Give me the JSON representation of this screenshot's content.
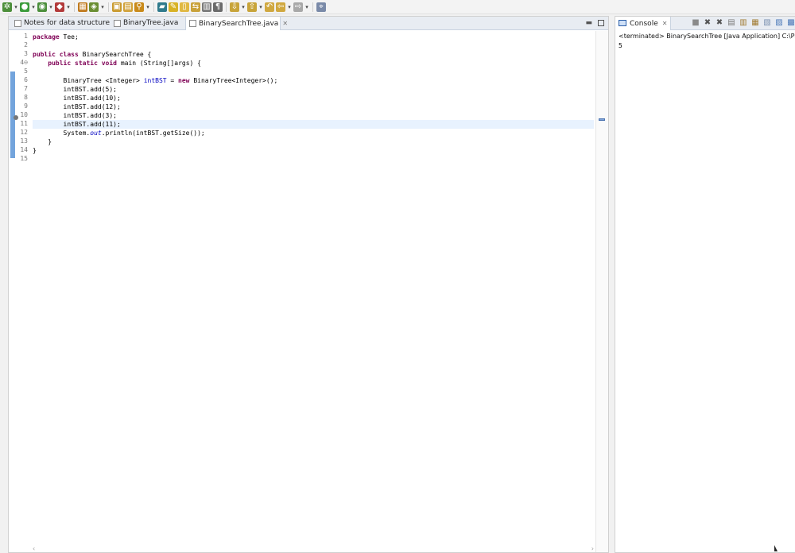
{
  "toolbar": {
    "icons": [
      {
        "name": "debug-icon",
        "color": "#4d8f3a"
      },
      {
        "name": "run-icon",
        "color": "#3b9b3b"
      },
      {
        "name": "coverage-icon",
        "color": "#4b8e3b"
      },
      {
        "name": "external-tools-icon",
        "color": "#b33a3a"
      },
      {
        "name": "new-java-project-icon",
        "color": "#c07a1e"
      },
      {
        "name": "new-package-icon",
        "color": "#6a8e32"
      },
      {
        "name": "open-type-icon",
        "color": "#c99a2e"
      },
      {
        "name": "open-folder-icon",
        "color": "#d1a23a"
      },
      {
        "name": "search-icon",
        "color": "#c98a1a"
      },
      {
        "name": "toggle-mark-occurrences-icon",
        "color": "#2f7a8c"
      },
      {
        "name": "highlight-icon",
        "color": "#d8b226"
      },
      {
        "name": "block-selection-icon",
        "color": "#e0b842"
      },
      {
        "name": "word-wrap-icon",
        "color": "#c9a23a"
      },
      {
        "name": "show-whitespace-icon",
        "color": "#7a7a7a"
      },
      {
        "name": "pilcrow-icon",
        "color": "#6b6b6b"
      },
      {
        "name": "next-annotation-icon",
        "color": "#c8a43a"
      },
      {
        "name": "previous-annotation-icon",
        "color": "#c8a43a"
      },
      {
        "name": "last-edit-location-icon",
        "color": "#d0a840"
      },
      {
        "name": "back-icon",
        "color": "#d0a840"
      },
      {
        "name": "forward-icon",
        "color": "#a8a8a8"
      },
      {
        "name": "pin-editor-icon",
        "color": "#7a8aa8"
      }
    ]
  },
  "editor": {
    "tabs": [
      {
        "label": "Notes for data structure",
        "active": false
      },
      {
        "label": "BinaryTree.java",
        "active": false
      },
      {
        "label": "BinarySearchTree.java",
        "active": true
      }
    ],
    "line_numbers": [
      "1",
      "2",
      "3",
      "4⊖",
      "5",
      "6",
      "7",
      "8",
      "9",
      "10",
      "11",
      "12",
      "13",
      "14",
      "15"
    ],
    "current_line": 11,
    "lines": [
      [
        {
          "t": "package",
          "c": "kw"
        },
        {
          "t": " Tee;",
          "c": ""
        }
      ],
      [],
      [
        {
          "t": "public",
          "c": "kw"
        },
        {
          "t": " ",
          "c": ""
        },
        {
          "t": "class",
          "c": "kw"
        },
        {
          "t": " BinarySearchTree {",
          "c": ""
        }
      ],
      [
        {
          "t": "    ",
          "c": ""
        },
        {
          "t": "public",
          "c": "kw"
        },
        {
          "t": " ",
          "c": ""
        },
        {
          "t": "static",
          "c": "kw"
        },
        {
          "t": " ",
          "c": ""
        },
        {
          "t": "void",
          "c": "kw"
        },
        {
          "t": " main (String[]args) {",
          "c": ""
        }
      ],
      [],
      [
        {
          "t": "        BinaryTree <Integer> ",
          "c": ""
        },
        {
          "t": "intBST",
          "c": "fld"
        },
        {
          "t": " = ",
          "c": ""
        },
        {
          "t": "new",
          "c": "kw"
        },
        {
          "t": " BinaryTree<Integer>();",
          "c": ""
        }
      ],
      [
        {
          "t": "        intBST.add(5);",
          "c": ""
        }
      ],
      [
        {
          "t": "        intBST.add(10);",
          "c": ""
        }
      ],
      [
        {
          "t": "        intBST.add(12);",
          "c": ""
        }
      ],
      [
        {
          "t": "        intBST.add(3);",
          "c": ""
        }
      ],
      [
        {
          "t": "        intBST.add(11);",
          "c": ""
        }
      ],
      [
        {
          "t": "        System.",
          "c": ""
        },
        {
          "t": "out",
          "c": "stat"
        },
        {
          "t": ".println(intBST.getSize());",
          "c": ""
        }
      ],
      [
        {
          "t": "    }",
          "c": ""
        }
      ],
      [
        {
          "t": "}",
          "c": ""
        }
      ],
      []
    ]
  },
  "console": {
    "tab_label": "Console",
    "status": "<terminated> BinarySearchTree [Java Application] C:\\Prog",
    "output": "5",
    "toolbar_icons": [
      "terminate-icon",
      "remove-launch-icon",
      "remove-all-terminated-icon",
      "clear-console-icon",
      "scroll-lock-icon",
      "word-wrap-icon",
      "show-console-icon",
      "pin-console-icon",
      "display-selected-console-icon"
    ]
  }
}
